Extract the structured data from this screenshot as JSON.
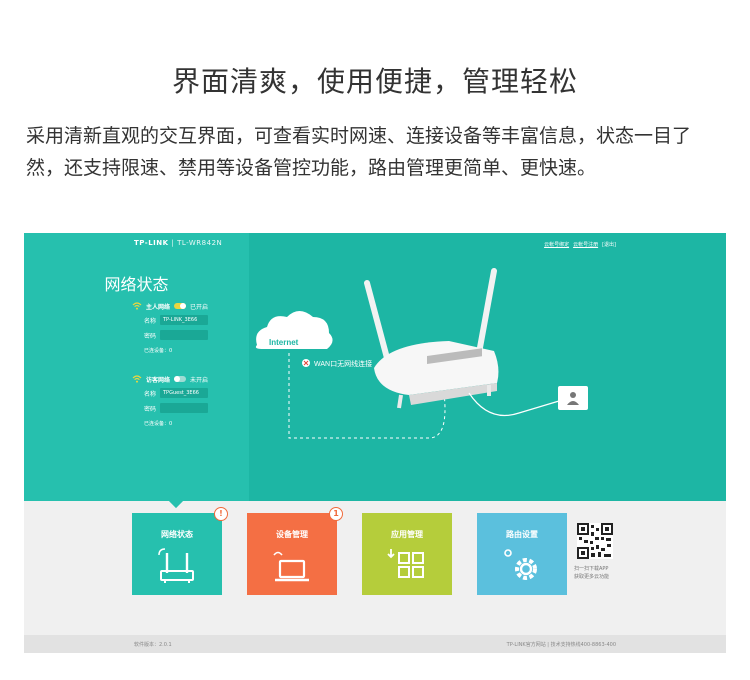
{
  "promo": {
    "headline": "界面清爽，使用便捷，管理轻松",
    "description": "采用清新直观的交互界面，可查看实时网速、连接设备等丰富信息，状态一目了然，还支持限速、禁用等设备管控功能，路由管理更简单、更快速。"
  },
  "router_ui": {
    "brand": "TP-LINK",
    "model": "TL-WR842N",
    "top_links": [
      "云帐号绑定",
      "云帐号注册"
    ],
    "exit_label": "[退出]",
    "network_status_title": "网络状态",
    "host_network": {
      "title": "主人网络",
      "toggle_state": "已开启",
      "name_label": "名称",
      "name_value": "TP-LINK_3E66",
      "password_label": "密码",
      "connected_label": "已连设备：0"
    },
    "guest_network": {
      "title": "访客网络",
      "toggle_state": "未开启",
      "name_label": "名称",
      "name_value": "TPGuest_3E66",
      "password_label": "密码",
      "connected_label": "已连设备：0"
    },
    "diagram": {
      "cloud_label": "Internet",
      "wan_error": "WAN口无网线连接"
    },
    "tiles": [
      {
        "label": "网络状态",
        "color": "#26c0ae",
        "badge": "!"
      },
      {
        "label": "设备管理",
        "color": "#f46f44",
        "badge": "1"
      },
      {
        "label": "应用管理",
        "color": "#b5cd3b",
        "badge": ""
      },
      {
        "label": "路由设置",
        "color": "#5bc0dd",
        "badge": ""
      }
    ],
    "qr_caption": [
      "扫一扫下载APP",
      "获取更多云功能"
    ],
    "footer": {
      "version": "软件版本：2.0.1",
      "site_link": "TP-LINK官方网站",
      "support": "技术支持热线400-8863-400"
    }
  }
}
